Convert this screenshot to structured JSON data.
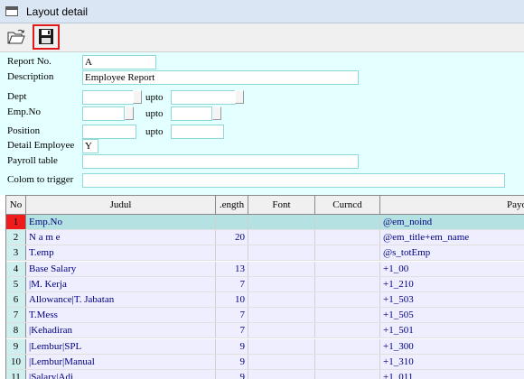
{
  "window": {
    "title": "Layout detail"
  },
  "toolbar": {
    "open_icon": "folder-open-icon",
    "save_icon": "floppy-save-icon",
    "highlight_color": "#e01a1a"
  },
  "form": {
    "report_no": {
      "label": "Report No.",
      "value": "A"
    },
    "description": {
      "label": "Description",
      "value": "Employee Report"
    },
    "dept": {
      "label": "Dept",
      "from": "",
      "to": "",
      "upto_label": "upto"
    },
    "emp_no": {
      "label": "Emp.No",
      "from": "",
      "to": "",
      "upto_label": "upto"
    },
    "position": {
      "label": "Position",
      "from": "",
      "to": "",
      "upto_label": "upto"
    },
    "detail_employee": {
      "label": "Detail Employee",
      "value": "Y"
    },
    "payroll_table": {
      "label": "Payroll table",
      "value": ""
    },
    "colom_to_trigger": {
      "label": "Colom to trigger",
      "value": ""
    }
  },
  "grid": {
    "columns": [
      "No",
      "Judul",
      ".ength",
      "Font",
      "Curncd",
      "Payo"
    ],
    "rows": [
      {
        "no": "1",
        "judul": "Emp.No",
        "length": "",
        "font": "",
        "curncd": "",
        "payo": "@em_noind"
      },
      {
        "no": "2",
        "judul": "N a m e",
        "length": "20",
        "font": "",
        "curncd": "",
        "payo": "@em_title+em_name"
      },
      {
        "no": "3",
        "judul": "T.emp",
        "length": "",
        "font": "",
        "curncd": "",
        "payo": "@s_totEmp"
      },
      {
        "no": "4",
        "judul": "Base Salary",
        "length": "13",
        "font": "",
        "curncd": "",
        "payo": "+1_00"
      },
      {
        "no": "5",
        "judul": "|M. Kerja",
        "length": "7",
        "font": "",
        "curncd": "",
        "payo": "+1_210"
      },
      {
        "no": "6",
        "judul": "Allowance|T. Jabatan",
        "length": "10",
        "font": "",
        "curncd": "",
        "payo": "+1_503"
      },
      {
        "no": "7",
        "judul": "T.Mess",
        "length": "7",
        "font": "",
        "curncd": "",
        "payo": "+1_505"
      },
      {
        "no": "8",
        "judul": "|Kehadiran",
        "length": "7",
        "font": "",
        "curncd": "",
        "payo": "+1_501"
      },
      {
        "no": "9",
        "judul": "|Lembur|SPL",
        "length": "9",
        "font": "",
        "curncd": "",
        "payo": "+1_300"
      },
      {
        "no": "10",
        "judul": "|Lembur|Manual",
        "length": "9",
        "font": "",
        "curncd": "",
        "payo": "+1_310"
      },
      {
        "no": "11",
        "judul": "|Salary|Adj",
        "length": "9",
        "font": "",
        "curncd": "",
        "payo": "+1_011"
      }
    ],
    "selected_row": 0
  },
  "colors": {
    "form_bg": "#e4ffff",
    "selected_row": "#b4e2e2",
    "selected_no": "#ee1c1c",
    "text_blue": "#000080"
  }
}
